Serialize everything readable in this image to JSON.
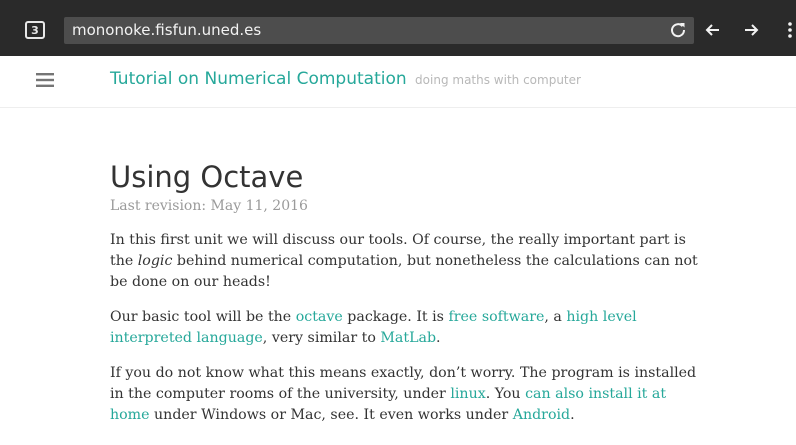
{
  "browser": {
    "tab_count": "3",
    "url": "mononoke.fisfun.uned.es"
  },
  "site": {
    "title": "Tutorial on Numerical Computation",
    "tagline": "doing maths with computer"
  },
  "article": {
    "heading": "Using Octave",
    "revision": "Last revision: May 11, 2016",
    "p1": {
      "a": "In this first unit we will discuss our tools. Of course, the really important part is the ",
      "em": "logic",
      "b": " behind numerical computation, but nonetheless the calculations can not be done on our heads!"
    },
    "p2": {
      "a": "Our basic tool will be the ",
      "link_octave": "octave",
      "b": " package. It is ",
      "link_free": "free software",
      "c": ", a ",
      "link_hll": "high level interpreted language",
      "d": ", very similar to ",
      "link_matlab": "MatLab",
      "e": "."
    },
    "p3": {
      "a": "If you do not know what this means exactly, don’t worry. The program is installed in the computer rooms of the university, under ",
      "link_linux": "linux",
      "b": ". You ",
      "link_home": "can also install it at home",
      "c": " under Windows or Mac, see. It even works under ",
      "link_android": "Android",
      "d": "."
    }
  }
}
